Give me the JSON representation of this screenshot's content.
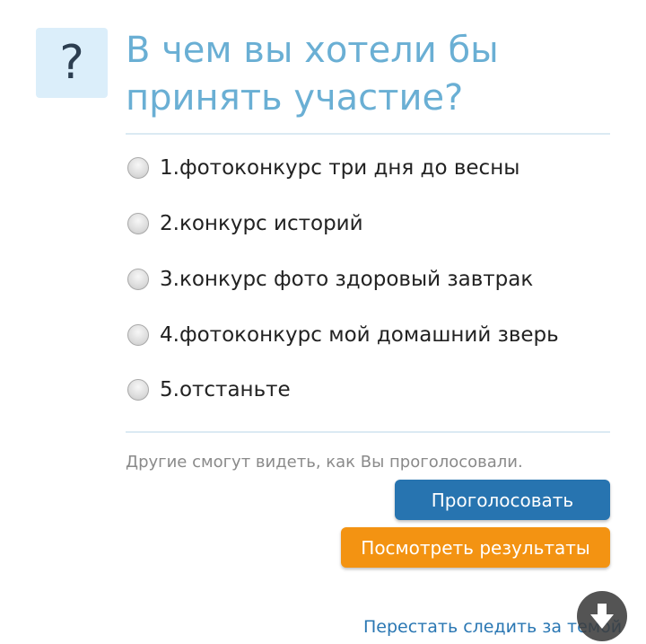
{
  "poll": {
    "question_icon": "?",
    "title": "В чем вы хотели бы принять участие?",
    "options": [
      {
        "label": "1.фотоконкурс три дня до весны",
        "selected": false
      },
      {
        "label": "2.конкурс историй",
        "selected": false
      },
      {
        "label": "3.конкурс фото здоровый завтрак",
        "selected": false
      },
      {
        "label": "4.фотоконкурс мой домашний зверь",
        "selected": false
      },
      {
        "label": "5.отстаньте",
        "selected": false
      }
    ],
    "visibility_note": "Другие смогут видеть, как Вы проголосовали.",
    "vote_label": "Проголосовать",
    "results_label": "Посмотреть результаты"
  },
  "footer": {
    "unfollow_label": "Перестать следить за темой"
  },
  "icons": {
    "scroll": "arrow-down-icon"
  },
  "colors": {
    "title": "#6aafd4",
    "question_box": "#dbeefa",
    "vote_button": "#2774b0",
    "results_button": "#f39312",
    "link": "#2a77b3"
  }
}
